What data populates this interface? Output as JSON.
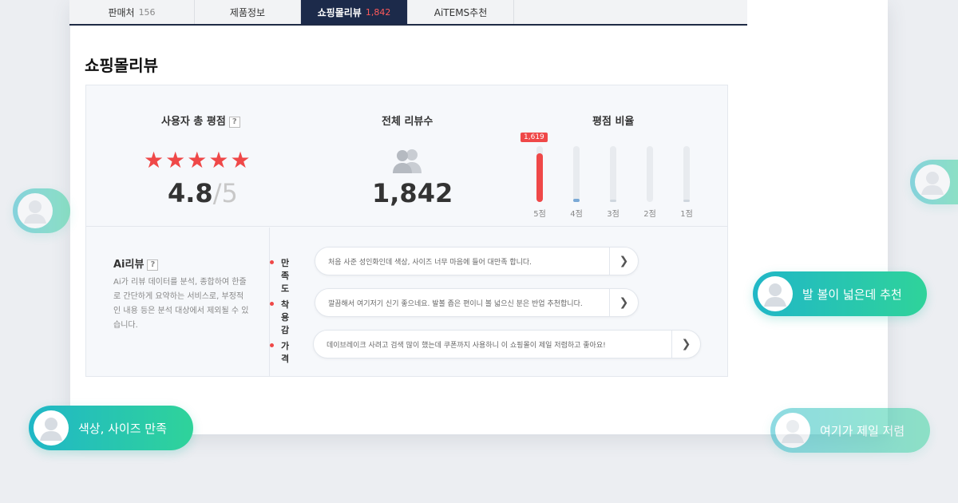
{
  "tabs": [
    {
      "label": "판매처",
      "count": "156"
    },
    {
      "label": "제품정보",
      "count": ""
    },
    {
      "label": "쇼핑몰리뷰",
      "count": "1,842"
    },
    {
      "label": "AiTEMS추천",
      "count": ""
    }
  ],
  "section_title": "쇼핑몰리뷰",
  "summary": {
    "rating_title": "사용자 총 평점",
    "help_icon": "?",
    "rating_value": "4.8",
    "rating_max": "/5",
    "stars": 5,
    "review_title": "전체 리뷰수",
    "review_count": "1,842",
    "ratio_title": "평점 비율",
    "ratio_bubble": "1,619"
  },
  "ratio": [
    {
      "label": "5점",
      "fraction": 0.87,
      "color": "#ef4848"
    },
    {
      "label": "4점",
      "fraction": 0.05,
      "color": "#7aa9d6"
    },
    {
      "label": "3점",
      "fraction": 0.01,
      "color": "#cfd6de"
    },
    {
      "label": "2점",
      "fraction": 0.0,
      "color": "#cfd6de"
    },
    {
      "label": "1점",
      "fraction": 0.01,
      "color": "#cfd6de"
    }
  ],
  "ai_review": {
    "title": "Ai리뷰",
    "help_icon": "?",
    "desc": "Ai가 리뷰 데이터를 분석, 종합하여 한줄로 간단하게 요약하는 서비스로, 부정적인 내용 등은 분석 대상에서 제외될 수 있습니다.",
    "rows": [
      {
        "label": "만족도",
        "text": "처음 사준 성인화인데 색상, 사이즈 너무 마음에 들어 대만족 합니다."
      },
      {
        "label": "착용감",
        "text": "깔끔해서 여기저기 신기 좋으네요. 발볼 좁은 편이니 볼 넓으신 분은 반업 추천합니다."
      },
      {
        "label": "가격",
        "text": "데이브레이크 사려고 검색 많이 했는데 쿠폰까지 사용하니 이 쇼핑몰이 제일 저렴하고 좋아요!"
      }
    ]
  },
  "chips": [
    {
      "text": "발 볼이 넓은데 추천"
    },
    {
      "text": "색상, 사이즈 만족"
    },
    {
      "text": "여기가 제일 저렴"
    },
    {
      "text": "",
      "partial": true
    },
    {
      "text": "",
      "partial": true
    }
  ],
  "icons": {
    "arrow": "chevron-right-icon",
    "people": "people-icon",
    "star": "star-icon",
    "avatar": "user-avatar-icon"
  },
  "colors": {
    "accent": "#ef4848",
    "nav": "#1c2a4a",
    "chip_start": "#20b7c7",
    "chip_end": "#2fd39a"
  }
}
